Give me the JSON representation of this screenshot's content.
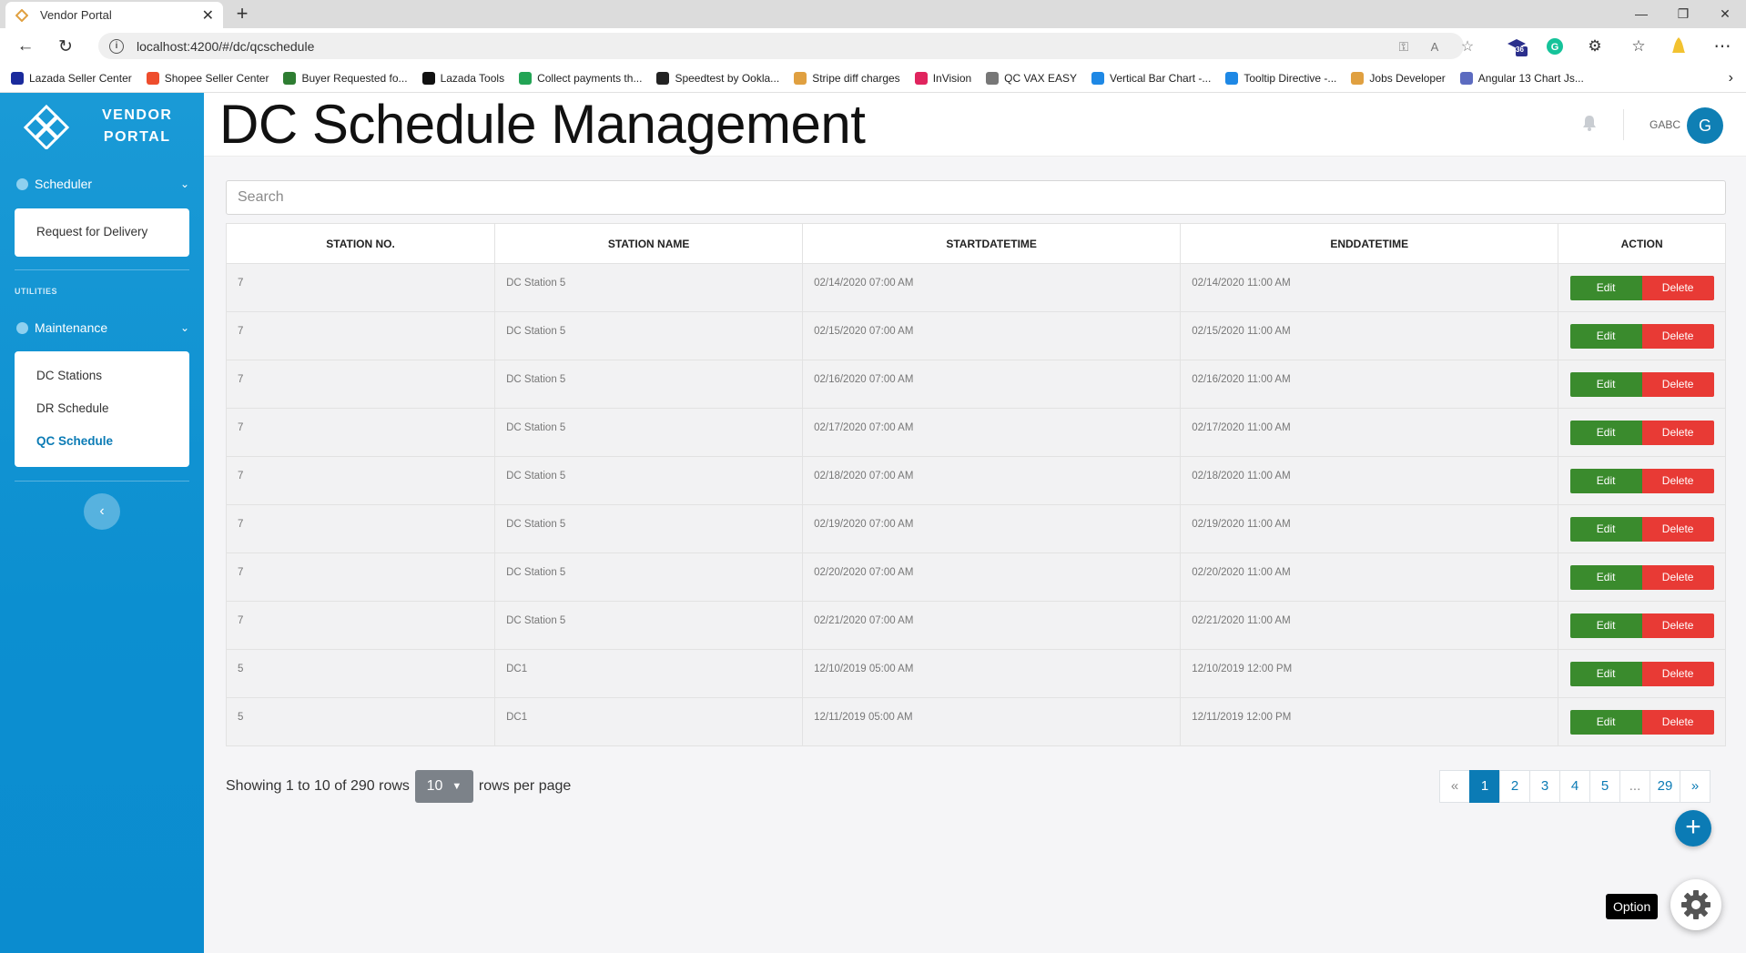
{
  "browser": {
    "tab_title": "Vendor Portal",
    "url": "localhost:4200/#/dc/qcschedule",
    "extension_badge": "36",
    "bookmarks": [
      {
        "label": "Lazada Seller Center",
        "color": "#1a2a9c"
      },
      {
        "label": "Shopee Seller Center",
        "color": "#ee4d2d"
      },
      {
        "label": "Buyer Requested fo...",
        "color": "#2e7d32"
      },
      {
        "label": "Lazada Tools",
        "color": "#111111"
      },
      {
        "label": "Collect payments th...",
        "color": "#23a455"
      },
      {
        "label": "Speedtest by Ookla...",
        "color": "#222222"
      },
      {
        "label": "Stripe diff charges",
        "color": "#e0a040"
      },
      {
        "label": "InVision",
        "color": "#e0245e"
      },
      {
        "label": "QC VAX EASY",
        "color": "#777777"
      },
      {
        "label": "Vertical Bar Chart -...",
        "color": "#1e88e5"
      },
      {
        "label": "Tooltip Directive -...",
        "color": "#1e88e5"
      },
      {
        "label": "Jobs Developer",
        "color": "#e0a040"
      },
      {
        "label": "Angular 13 Chart Js...",
        "color": "#5c6bc0"
      }
    ]
  },
  "sidebar": {
    "brand_line1": "VENDOR",
    "brand_line2": "PORTAL",
    "scheduler_label": "Scheduler",
    "scheduler_items": [
      {
        "label": "Request for Delivery"
      }
    ],
    "utilities_label": "UTILITIES",
    "maintenance_label": "Maintenance",
    "maintenance_items": [
      {
        "label": "DC Stations",
        "active": false
      },
      {
        "label": "DR Schedule",
        "active": false
      },
      {
        "label": "QC Schedule",
        "active": true
      }
    ],
    "collapse_icon": "chevron-left-icon"
  },
  "header": {
    "title": "DC Schedule Management",
    "username": "GABC",
    "avatar_initial": "G"
  },
  "search": {
    "placeholder": "Search",
    "value": ""
  },
  "table": {
    "columns": [
      "STATION NO.",
      "STATION NAME",
      "STARTDATETIME",
      "ENDDATETIME",
      "ACTION"
    ],
    "edit_label": "Edit",
    "delete_label": "Delete",
    "rows": [
      {
        "station_no": "7",
        "station_name": "DC Station 5",
        "start": "02/14/2020 07:00 AM",
        "end": "02/14/2020 11:00 AM"
      },
      {
        "station_no": "7",
        "station_name": "DC Station 5",
        "start": "02/15/2020 07:00 AM",
        "end": "02/15/2020 11:00 AM"
      },
      {
        "station_no": "7",
        "station_name": "DC Station 5",
        "start": "02/16/2020 07:00 AM",
        "end": "02/16/2020 11:00 AM"
      },
      {
        "station_no": "7",
        "station_name": "DC Station 5",
        "start": "02/17/2020 07:00 AM",
        "end": "02/17/2020 11:00 AM"
      },
      {
        "station_no": "7",
        "station_name": "DC Station 5",
        "start": "02/18/2020 07:00 AM",
        "end": "02/18/2020 11:00 AM"
      },
      {
        "station_no": "7",
        "station_name": "DC Station 5",
        "start": "02/19/2020 07:00 AM",
        "end": "02/19/2020 11:00 AM"
      },
      {
        "station_no": "7",
        "station_name": "DC Station 5",
        "start": "02/20/2020 07:00 AM",
        "end": "02/20/2020 11:00 AM"
      },
      {
        "station_no": "7",
        "station_name": "DC Station 5",
        "start": "02/21/2020 07:00 AM",
        "end": "02/21/2020 11:00 AM"
      },
      {
        "station_no": "5",
        "station_name": "DC1",
        "start": "12/10/2019 05:00 AM",
        "end": "12/10/2019 12:00 PM"
      },
      {
        "station_no": "5",
        "station_name": "DC1",
        "start": "12/11/2019 05:00 AM",
        "end": "12/11/2019 12:00 PM"
      }
    ]
  },
  "footer": {
    "showing_text": "Showing 1 to 10 of 290 rows",
    "rows_per_page_value": "10",
    "rows_per_page_suffix": "rows per page"
  },
  "pagination": {
    "items": [
      {
        "label": "«",
        "kind": "muted"
      },
      {
        "label": "1",
        "kind": "active"
      },
      {
        "label": "2",
        "kind": ""
      },
      {
        "label": "3",
        "kind": ""
      },
      {
        "label": "4",
        "kind": ""
      },
      {
        "label": "5",
        "kind": ""
      },
      {
        "label": "...",
        "kind": "muted"
      },
      {
        "label": "29",
        "kind": ""
      },
      {
        "label": "»",
        "kind": ""
      }
    ]
  },
  "fab": {
    "add_icon": "plus-icon",
    "option_tooltip": "Option",
    "settings_icon": "gear-icon"
  },
  "colors": {
    "sidebar": "#0c8fd0",
    "accent": "#0b7bb5",
    "edit": "#3a8b2d",
    "delete": "#e83a35"
  }
}
